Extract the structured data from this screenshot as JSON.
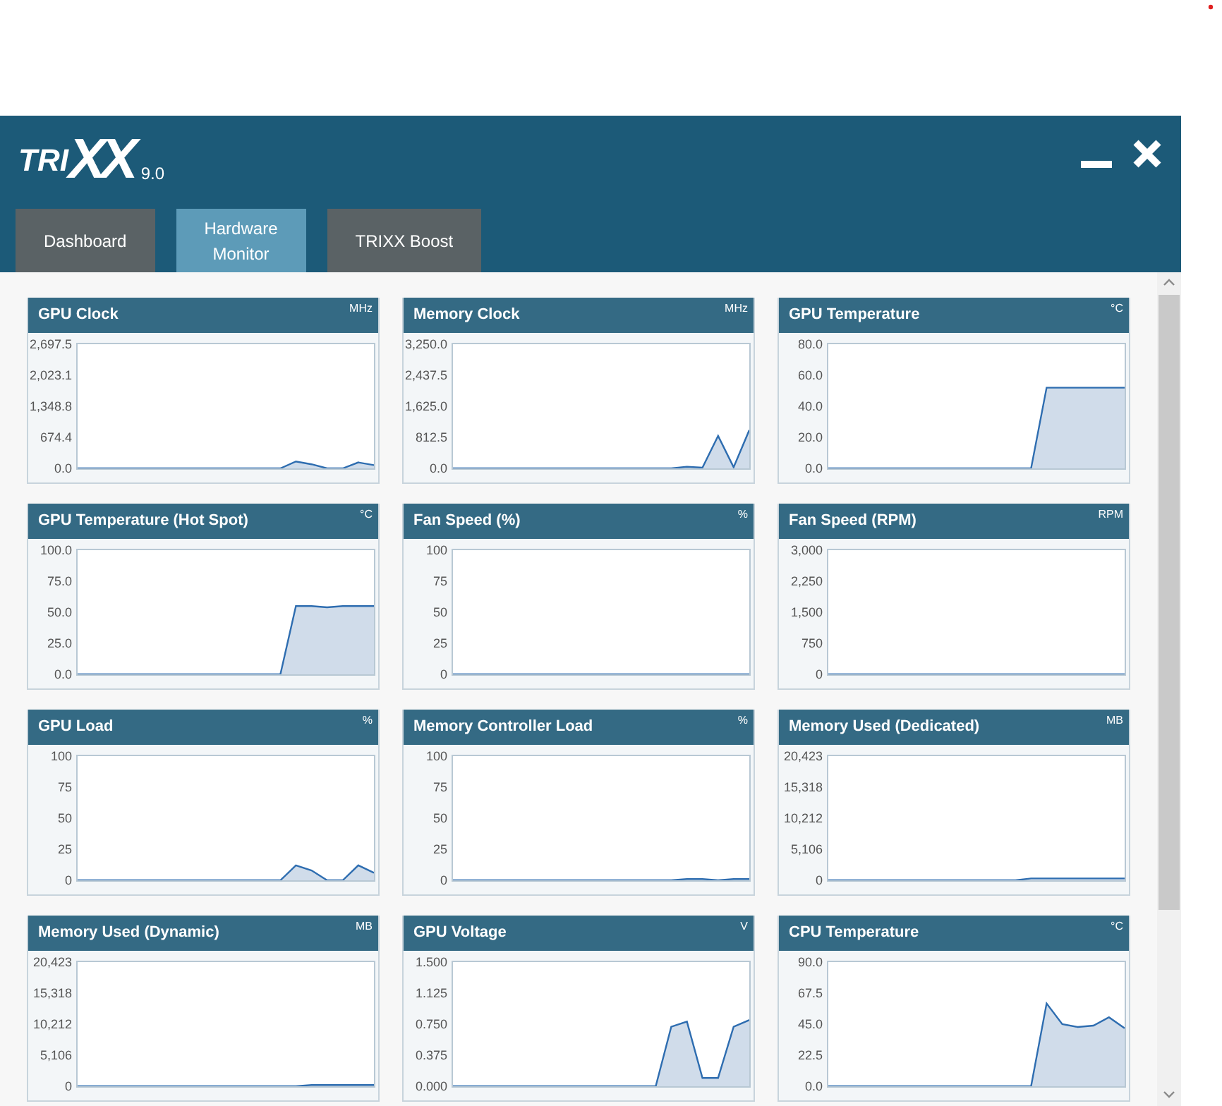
{
  "window": {
    "logo_prefix": "TRI",
    "logo_mark": "XX",
    "version": "9.0"
  },
  "tabs": [
    {
      "label": "Dashboard",
      "selected": false
    },
    {
      "label": "Hardware\nMonitor",
      "selected": true
    },
    {
      "label": "TRIXX Boost",
      "selected": false
    }
  ],
  "cards": [
    {
      "title": "GPU Clock",
      "unit": "MHz",
      "chart_data": {
        "type": "area",
        "categories": [
          null,
          null,
          null,
          null,
          null,
          null,
          null,
          null,
          null,
          null,
          null,
          null,
          null,
          null,
          null,
          null,
          null,
          null,
          null,
          null
        ],
        "ylim": [
          0,
          2697.5
        ],
        "yticks": [
          {
            "value": 0,
            "label": "0.0"
          },
          {
            "value": 674.4,
            "label": "674.4"
          },
          {
            "value": 1348.8,
            "label": "1,348.8"
          },
          {
            "value": 2023.1,
            "label": "2,023.1"
          },
          {
            "value": 2697.5,
            "label": "2,697.5"
          }
        ],
        "series": [
          {
            "color": "#2e6db0",
            "values": [
              0,
              0,
              0,
              0,
              0,
              0,
              0,
              0,
              0,
              0,
              0,
              0,
              0,
              0,
              150,
              90,
              0,
              0,
              130,
              70
            ]
          }
        ]
      }
    },
    {
      "title": "Memory Clock",
      "unit": "MHz",
      "chart_data": {
        "type": "area",
        "categories": [
          null,
          null,
          null,
          null,
          null,
          null,
          null,
          null,
          null,
          null,
          null,
          null,
          null,
          null,
          null,
          null,
          null,
          null,
          null,
          null
        ],
        "ylim": [
          0,
          3250
        ],
        "yticks": [
          {
            "value": 0,
            "label": "0.0"
          },
          {
            "value": 812.5,
            "label": "812.5"
          },
          {
            "value": 1625,
            "label": "1,625.0"
          },
          {
            "value": 2437.5,
            "label": "2,437.5"
          },
          {
            "value": 3250,
            "label": "3,250.0"
          }
        ],
        "series": [
          {
            "color": "#2e6db0",
            "values": [
              0,
              0,
              0,
              0,
              0,
              0,
              0,
              0,
              0,
              0,
              0,
              0,
              0,
              0,
              0,
              40,
              20,
              850,
              30,
              1000
            ]
          }
        ]
      }
    },
    {
      "title": "GPU Temperature",
      "unit": "°C",
      "chart_data": {
        "type": "area",
        "categories": [
          null,
          null,
          null,
          null,
          null,
          null,
          null,
          null,
          null,
          null,
          null,
          null,
          null,
          null,
          null,
          null,
          null,
          null,
          null,
          null
        ],
        "ylim": [
          0,
          80
        ],
        "yticks": [
          {
            "value": 0,
            "label": "0.0"
          },
          {
            "value": 20,
            "label": "20.0"
          },
          {
            "value": 40,
            "label": "40.0"
          },
          {
            "value": 60,
            "label": "60.0"
          },
          {
            "value": 80,
            "label": "80.0"
          }
        ],
        "series": [
          {
            "color": "#2e6db0",
            "values": [
              0,
              0,
              0,
              0,
              0,
              0,
              0,
              0,
              0,
              0,
              0,
              0,
              0,
              0,
              52,
              52,
              52,
              52,
              52,
              52
            ]
          }
        ]
      }
    },
    {
      "title": "GPU Temperature (Hot Spot)",
      "unit": "°C",
      "chart_data": {
        "type": "area",
        "categories": [
          null,
          null,
          null,
          null,
          null,
          null,
          null,
          null,
          null,
          null,
          null,
          null,
          null,
          null,
          null,
          null,
          null,
          null,
          null,
          null
        ],
        "ylim": [
          0,
          100
        ],
        "yticks": [
          {
            "value": 0,
            "label": "0.0"
          },
          {
            "value": 25,
            "label": "25.0"
          },
          {
            "value": 50,
            "label": "50.0"
          },
          {
            "value": 75,
            "label": "75.0"
          },
          {
            "value": 100,
            "label": "100.0"
          }
        ],
        "series": [
          {
            "color": "#2e6db0",
            "values": [
              0,
              0,
              0,
              0,
              0,
              0,
              0,
              0,
              0,
              0,
              0,
              0,
              0,
              0,
              55,
              55,
              54,
              55,
              55,
              55
            ]
          }
        ]
      }
    },
    {
      "title": "Fan Speed (%)",
      "unit": "%",
      "chart_data": {
        "type": "line",
        "categories": [
          null,
          null,
          null,
          null,
          null,
          null,
          null,
          null,
          null,
          null,
          null,
          null,
          null,
          null,
          null,
          null,
          null,
          null,
          null,
          null
        ],
        "ylim": [
          0,
          100
        ],
        "yticks": [
          {
            "value": 0,
            "label": "0"
          },
          {
            "value": 25,
            "label": "25"
          },
          {
            "value": 50,
            "label": "50"
          },
          {
            "value": 75,
            "label": "75"
          },
          {
            "value": 100,
            "label": "100"
          }
        ],
        "series": [
          {
            "color": "#2e6db0",
            "values": [
              0,
              0,
              0,
              0,
              0,
              0,
              0,
              0,
              0,
              0,
              0,
              0,
              0,
              0,
              0,
              0,
              0,
              0,
              0,
              0
            ]
          }
        ]
      }
    },
    {
      "title": "Fan Speed (RPM)",
      "unit": "RPM",
      "chart_data": {
        "type": "line",
        "categories": [
          null,
          null,
          null,
          null,
          null,
          null,
          null,
          null,
          null,
          null,
          null,
          null,
          null,
          null,
          null,
          null,
          null,
          null,
          null,
          null
        ],
        "ylim": [
          0,
          3000
        ],
        "yticks": [
          {
            "value": 0,
            "label": "0"
          },
          {
            "value": 750,
            "label": "750"
          },
          {
            "value": 1500,
            "label": "1,500"
          },
          {
            "value": 2250,
            "label": "2,250"
          },
          {
            "value": 3000,
            "label": "3,000"
          }
        ],
        "series": [
          {
            "color": "#2e6db0",
            "values": [
              0,
              0,
              0,
              0,
              0,
              0,
              0,
              0,
              0,
              0,
              0,
              0,
              0,
              0,
              0,
              0,
              0,
              0,
              0,
              0
            ]
          }
        ]
      }
    },
    {
      "title": "GPU Load",
      "unit": "%",
      "chart_data": {
        "type": "area",
        "categories": [
          null,
          null,
          null,
          null,
          null,
          null,
          null,
          null,
          null,
          null,
          null,
          null,
          null,
          null,
          null,
          null,
          null,
          null,
          null,
          null
        ],
        "ylim": [
          0,
          100
        ],
        "yticks": [
          {
            "value": 0,
            "label": "0"
          },
          {
            "value": 25,
            "label": "25"
          },
          {
            "value": 50,
            "label": "50"
          },
          {
            "value": 75,
            "label": "75"
          },
          {
            "value": 100,
            "label": "100"
          }
        ],
        "series": [
          {
            "color": "#2e6db0",
            "values": [
              0,
              0,
              0,
              0,
              0,
              0,
              0,
              0,
              0,
              0,
              0,
              0,
              0,
              0,
              12,
              8,
              0,
              0,
              12,
              6
            ]
          }
        ]
      }
    },
    {
      "title": "Memory Controller Load",
      "unit": "%",
      "chart_data": {
        "type": "area",
        "categories": [
          null,
          null,
          null,
          null,
          null,
          null,
          null,
          null,
          null,
          null,
          null,
          null,
          null,
          null,
          null,
          null,
          null,
          null,
          null,
          null
        ],
        "ylim": [
          0,
          100
        ],
        "yticks": [
          {
            "value": 0,
            "label": "0"
          },
          {
            "value": 25,
            "label": "25"
          },
          {
            "value": 50,
            "label": "50"
          },
          {
            "value": 75,
            "label": "75"
          },
          {
            "value": 100,
            "label": "100"
          }
        ],
        "series": [
          {
            "color": "#2e6db0",
            "values": [
              0,
              0,
              0,
              0,
              0,
              0,
              0,
              0,
              0,
              0,
              0,
              0,
              0,
              0,
              0,
              1,
              1,
              0,
              1,
              1
            ]
          }
        ]
      }
    },
    {
      "title": "Memory Used (Dedicated)",
      "unit": "MB",
      "chart_data": {
        "type": "area",
        "categories": [
          null,
          null,
          null,
          null,
          null,
          null,
          null,
          null,
          null,
          null,
          null,
          null,
          null,
          null,
          null,
          null,
          null,
          null,
          null,
          null
        ],
        "ylim": [
          0,
          20423
        ],
        "yticks": [
          {
            "value": 0,
            "label": "0"
          },
          {
            "value": 5106,
            "label": "5,106"
          },
          {
            "value": 10212,
            "label": "10,212"
          },
          {
            "value": 15318,
            "label": "15,318"
          },
          {
            "value": 20423,
            "label": "20,423"
          }
        ],
        "series": [
          {
            "color": "#2e6db0",
            "values": [
              0,
              0,
              0,
              0,
              0,
              0,
              0,
              0,
              0,
              0,
              0,
              0,
              0,
              300,
              300,
              300,
              300,
              300,
              300,
              300
            ]
          }
        ]
      }
    },
    {
      "title": "Memory Used (Dynamic)",
      "unit": "MB",
      "chart_data": {
        "type": "area",
        "categories": [
          null,
          null,
          null,
          null,
          null,
          null,
          null,
          null,
          null,
          null,
          null,
          null,
          null,
          null,
          null,
          null,
          null,
          null,
          null,
          null
        ],
        "ylim": [
          0,
          20423
        ],
        "yticks": [
          {
            "value": 0,
            "label": "0"
          },
          {
            "value": 5106,
            "label": "5,106"
          },
          {
            "value": 10212,
            "label": "10,212"
          },
          {
            "value": 15318,
            "label": "15,318"
          },
          {
            "value": 20423,
            "label": "20,423"
          }
        ],
        "series": [
          {
            "color": "#2e6db0",
            "values": [
              0,
              0,
              0,
              0,
              0,
              0,
              0,
              0,
              0,
              0,
              0,
              0,
              0,
              0,
              0,
              200,
              200,
              200,
              200,
              200
            ]
          }
        ]
      }
    },
    {
      "title": "GPU Voltage",
      "unit": "V",
      "chart_data": {
        "type": "area",
        "categories": [
          null,
          null,
          null,
          null,
          null,
          null,
          null,
          null,
          null,
          null,
          null,
          null,
          null,
          null,
          null,
          null,
          null,
          null,
          null,
          null
        ],
        "ylim": [
          0,
          1.5
        ],
        "yticks": [
          {
            "value": 0,
            "label": "0.000"
          },
          {
            "value": 0.375,
            "label": "0.375"
          },
          {
            "value": 0.75,
            "label": "0.750"
          },
          {
            "value": 1.125,
            "label": "1.125"
          },
          {
            "value": 1.5,
            "label": "1.500"
          }
        ],
        "series": [
          {
            "color": "#2e6db0",
            "values": [
              0,
              0,
              0,
              0,
              0,
              0,
              0,
              0,
              0,
              0,
              0,
              0,
              0,
              0,
              0.72,
              0.78,
              0.1,
              0.1,
              0.72,
              0.8
            ]
          }
        ]
      }
    },
    {
      "title": "CPU Temperature",
      "unit": "°C",
      "chart_data": {
        "type": "area",
        "categories": [
          null,
          null,
          null,
          null,
          null,
          null,
          null,
          null,
          null,
          null,
          null,
          null,
          null,
          null,
          null,
          null,
          null,
          null,
          null,
          null
        ],
        "ylim": [
          0,
          90
        ],
        "yticks": [
          {
            "value": 0,
            "label": "0.0"
          },
          {
            "value": 22.5,
            "label": "22.5"
          },
          {
            "value": 45,
            "label": "45.0"
          },
          {
            "value": 67.5,
            "label": "67.5"
          },
          {
            "value": 90,
            "label": "90.0"
          }
        ],
        "series": [
          {
            "color": "#2e6db0",
            "values": [
              0,
              0,
              0,
              0,
              0,
              0,
              0,
              0,
              0,
              0,
              0,
              0,
              0,
              0,
              60,
              45,
              43,
              44,
              50,
              42
            ]
          }
        ]
      }
    }
  ]
}
